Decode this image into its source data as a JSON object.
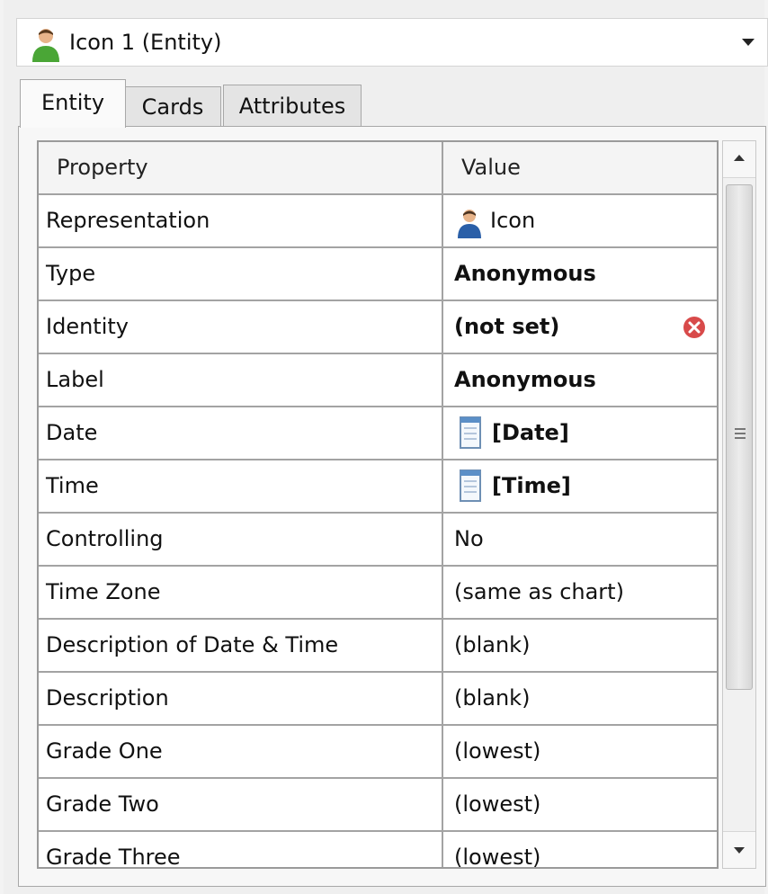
{
  "entity_selector": {
    "title": "Icon 1 (Entity)",
    "icon": "person-icon"
  },
  "tabs": [
    {
      "label": "Entity",
      "active": true
    },
    {
      "label": "Cards",
      "active": false
    },
    {
      "label": "Attributes",
      "active": false
    }
  ],
  "grid": {
    "headers": {
      "property": "Property",
      "value": "Value"
    },
    "rows": [
      {
        "property": "Representation",
        "value": "Icon",
        "bold": false,
        "icon": "person-icon"
      },
      {
        "property": "Type",
        "value": "Anonymous",
        "bold": true
      },
      {
        "property": "Identity",
        "value": "(not set)",
        "bold": true,
        "action_icon": "clear-icon"
      },
      {
        "property": "Label",
        "value": "Anonymous",
        "bold": true
      },
      {
        "property": "Date",
        "value": "[Date]",
        "bold": true,
        "icon": "calendar-icon"
      },
      {
        "property": "Time",
        "value": "[Time]",
        "bold": true,
        "icon": "calendar-icon"
      },
      {
        "property": "Controlling",
        "value": "No",
        "bold": false
      },
      {
        "property": "Time Zone",
        "value": "(same as chart)",
        "bold": false
      },
      {
        "property": "Description of Date & Time",
        "value": "(blank)",
        "bold": false
      },
      {
        "property": "Description",
        "value": "(blank)",
        "bold": false
      },
      {
        "property": "Grade One",
        "value": "(lowest)",
        "bold": false
      },
      {
        "property": "Grade Two",
        "value": "(lowest)",
        "bold": false
      },
      {
        "property": "Grade Three",
        "value": "(lowest)",
        "bold": false
      }
    ]
  },
  "colors": {
    "clear_icon": "#d84a4a",
    "person_shirt_green": "#4aa636",
    "person_shirt_blue": "#2a5fa8"
  }
}
